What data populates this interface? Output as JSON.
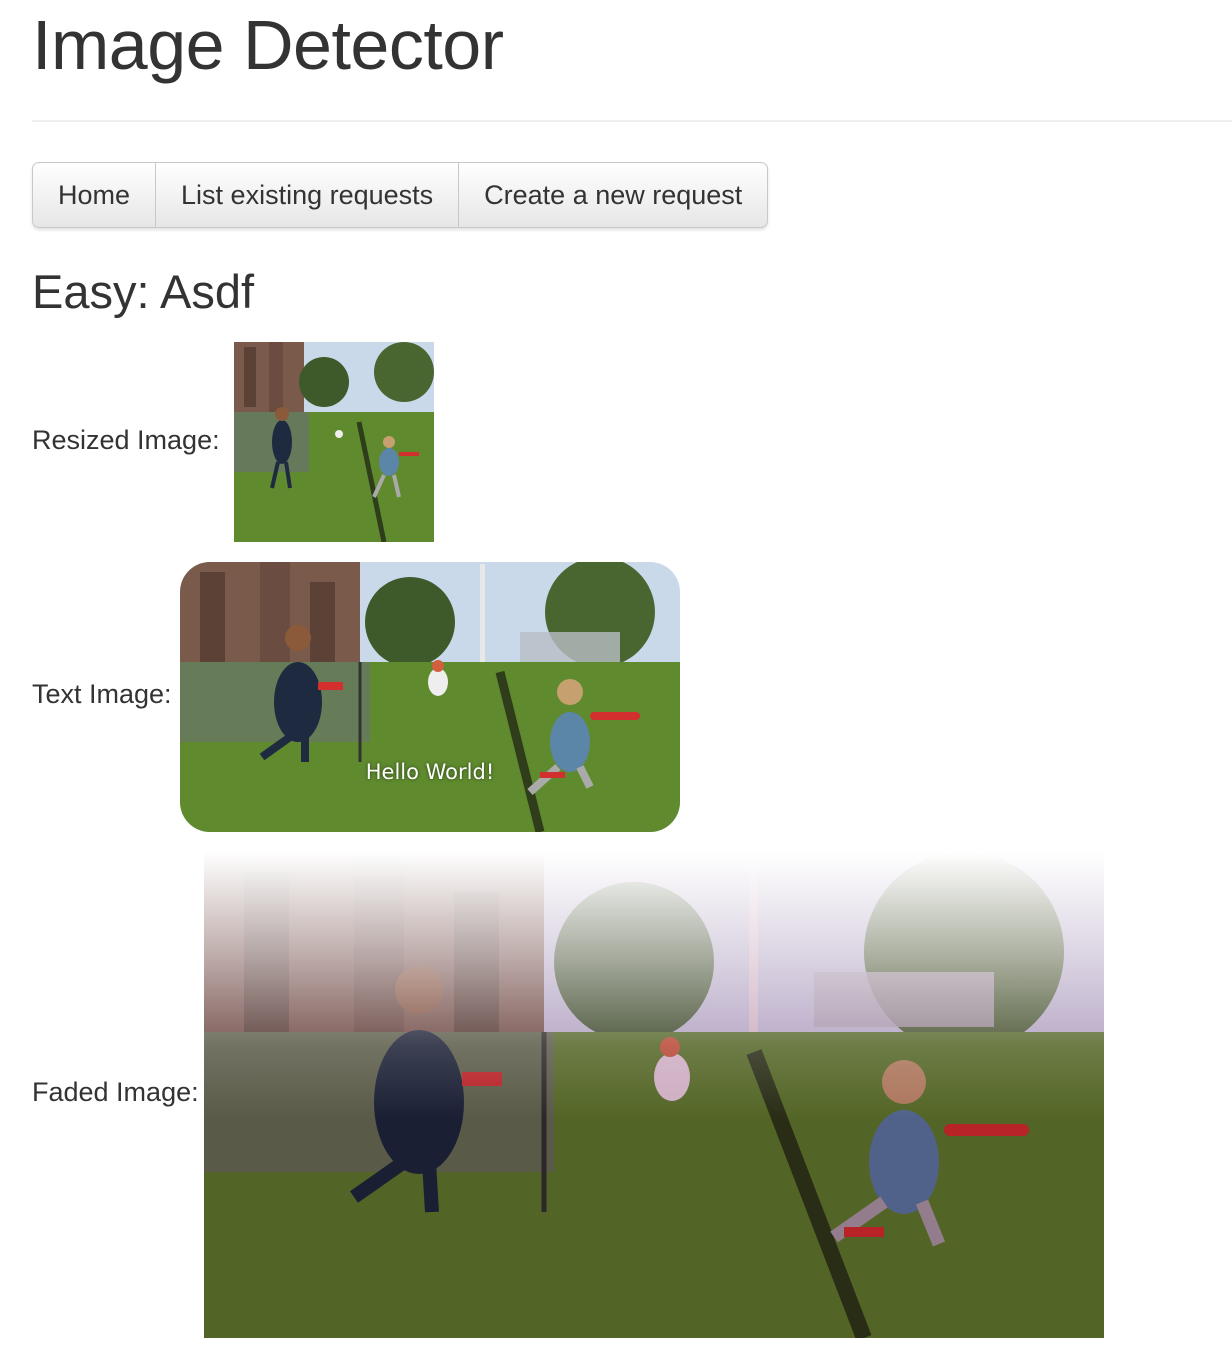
{
  "app": {
    "title": "Image Detector"
  },
  "nav": {
    "items": [
      {
        "label": "Home"
      },
      {
        "label": "List existing requests"
      },
      {
        "label": "Create a new request"
      }
    ]
  },
  "request": {
    "title": "Easy: Asdf",
    "rows": [
      {
        "label": "Resized Image:"
      },
      {
        "label": "Text Image:",
        "overlay_text": "Hello World!"
      },
      {
        "label": "Faded Image:"
      }
    ]
  },
  "colors": {
    "text": "#333333",
    "rule": "#eeeeee",
    "nav_border": "#c8c8c8",
    "grass": "#5f8a2e",
    "sky": "#c9d9ea"
  }
}
